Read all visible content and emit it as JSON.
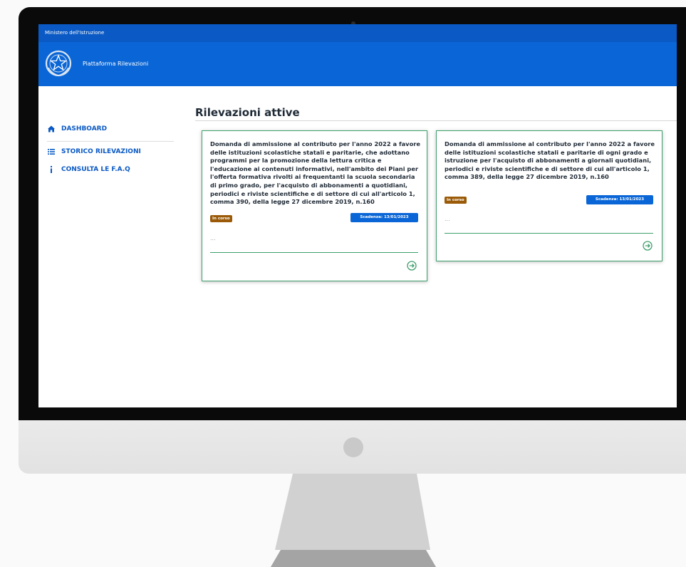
{
  "header": {
    "ministry": "Ministero dell'Istruzione",
    "platform": "Piattaforma Rilevazioni"
  },
  "sidebar": {
    "items": [
      {
        "label": "DASHBOARD",
        "icon": "home-icon"
      },
      {
        "label": "STORICO RILEVAZIONI",
        "icon": "list-icon"
      },
      {
        "label": "CONSULTA LE F.A.Q",
        "icon": "info-icon"
      }
    ]
  },
  "main": {
    "title": "Rilevazioni attive",
    "cards": [
      {
        "text": "Domanda di ammissione al contributo per l'anno 2022 a favore delle istituzioni scolastiche statali e paritarie, che adottano programmi per la promozione della lettura critica e l'educazione ai contenuti informativi, nell'ambito dei Piani per l'offerta formativa rivolti ai frequentanti la scuola secondaria di primo grado, per l'acquisto di abbonamenti a quotidiani, periodici e riviste scientifiche e di settore di cui all'articolo 1, comma 390, della legge 27 dicembre 2019, n.160",
        "status": "In corso",
        "deadline": "Scadenza: 13/01/2023",
        "ellipsis": "..."
      },
      {
        "text": "Domanda di ammissione al contributo per l'anno 2022 a favore delle istituzioni scolastiche statali e paritarie di ogni grado e istruzione per l'acquisto di abbonamenti a giornali quotidiani, periodici e riviste scientifiche e di settore di cui all'articolo 1, comma 389, della legge 27 dicembre 2019, n.160",
        "status": "In corso",
        "deadline": "Scadenza: 13/01/2023",
        "ellipsis": "..."
      }
    ]
  },
  "colors": {
    "topbar": "#0a59c4",
    "brandbar": "#0a66d6",
    "card_border": "#3e9f6c",
    "status_badge": "#9a5a07"
  }
}
